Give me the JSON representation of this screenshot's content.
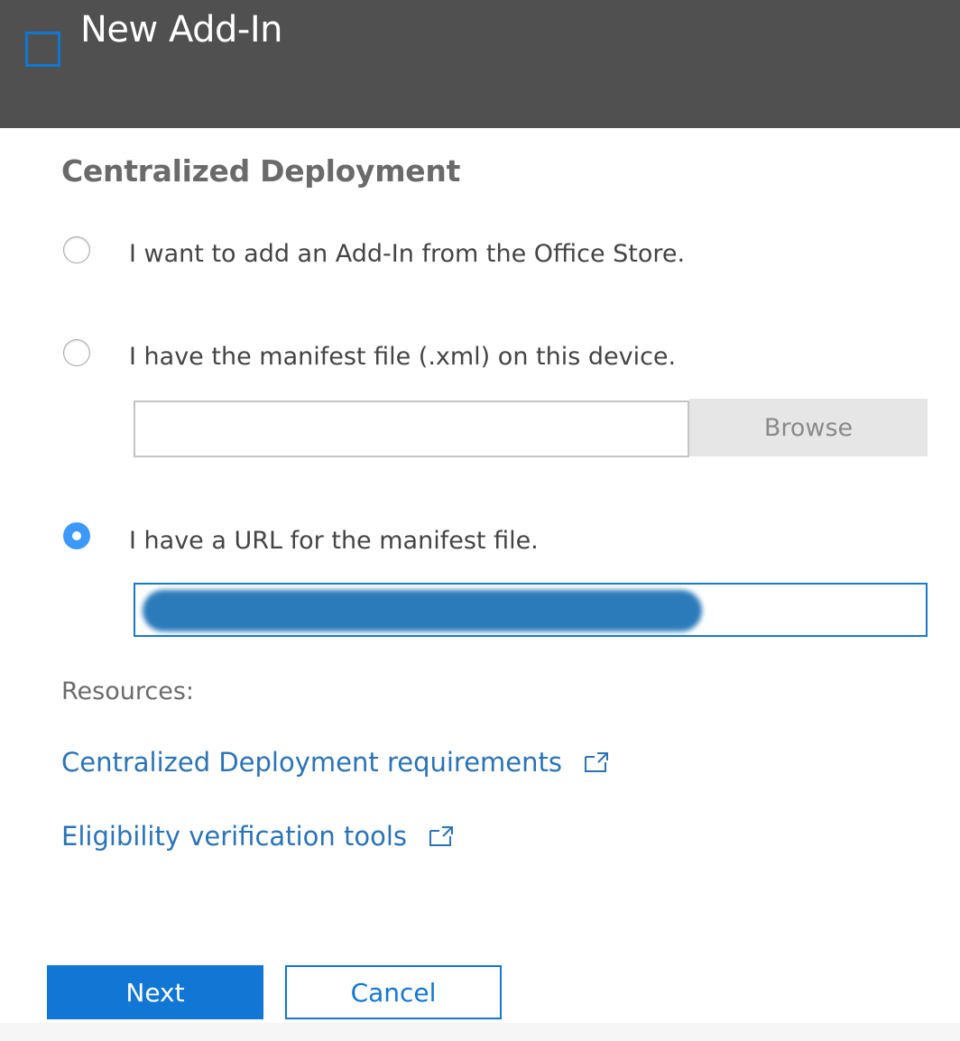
{
  "header": {
    "title": "New Add-In",
    "icon": "square-outline-icon",
    "background_color": "#505050",
    "accent_color": "#0f78d4"
  },
  "section": {
    "title": "Centralized Deployment"
  },
  "options": [
    {
      "label": "I want to add an Add-In from the Office Store.",
      "checked": false
    },
    {
      "label": "I have the manifest file (.xml) on this device.",
      "checked": false
    },
    {
      "label": "I have a URL for the manifest file.",
      "checked": true
    }
  ],
  "file_input": {
    "value": "",
    "browse_label": "Browse"
  },
  "url_input": {
    "value_redacted": true
  },
  "resources": {
    "label": "Resources:",
    "links": [
      {
        "label": "Centralized Deployment requirements",
        "icon": "external-link-icon"
      },
      {
        "label": "Eligibility verification tools",
        "icon": "external-link-icon"
      }
    ],
    "link_color": "#2a73b7"
  },
  "actions": {
    "next_label": "Next",
    "cancel_label": "Cancel",
    "primary_color": "#1176d4"
  }
}
